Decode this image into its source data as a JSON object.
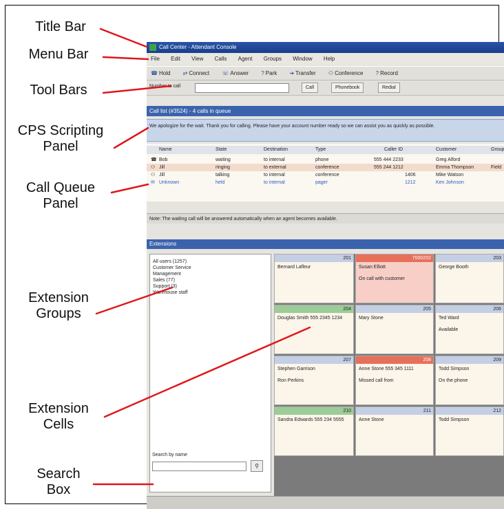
{
  "callouts": {
    "title_bar": "Title Bar",
    "menu_bar": "Menu Bar",
    "tool_bars": "Tool Bars",
    "cps_line1": "CPS Scripting",
    "cps_line2": "Panel",
    "queue_line1": "Call Queue",
    "queue_line2": "Panel",
    "groups_line1": "Extension",
    "groups_line2": "Groups",
    "cells_line1": "Extension",
    "cells_line2": "Cells",
    "search_line1": "Search",
    "search_line2": "Box"
  },
  "colors": {
    "callout_line": "#e0161b",
    "title_bar": "#1f4596",
    "panel_header": "#3b63ad",
    "script_panel": "#c9d6ea",
    "ringing_cell": "#e7705b",
    "talking_cell": "#9ccc97",
    "cells_background": "#7b7b7b"
  },
  "app": {
    "title": "Call Center - Attendant Console",
    "menu": [
      "File",
      "Edit",
      "View",
      "Calls",
      "Agent",
      "Groups",
      "Window",
      "Help"
    ],
    "toolbar_buttons": [
      {
        "icon": "hold-icon",
        "label": "Hold"
      },
      {
        "icon": "transfer-icon",
        "label": "Connect"
      },
      {
        "icon": "answer-icon",
        "label": "Answer"
      },
      {
        "icon": "park-icon",
        "label": "Park"
      },
      {
        "icon": "transfer-icon",
        "label": "Transfer"
      },
      {
        "icon": "conference-icon",
        "label": "Conference"
      },
      {
        "icon": "record-icon",
        "label": "Record"
      }
    ],
    "dial_label": "Number to call",
    "dial_buttons": [
      "Call",
      "Phonebook",
      "Redial"
    ],
    "call_list_title": "Call list (#3524) - 4 calls in queue",
    "script_text": "We apologize for the wait. Thank you for calling. Please have your account number ready so we can assist you as quickly as possible.",
    "queue_columns": [
      "Name",
      "State",
      "Destination",
      "Type",
      "Caller ID",
      "Customer",
      "Group"
    ],
    "queue_rows": [
      {
        "name": "Bob",
        "state": "waiting",
        "dest": "to internal",
        "type": "phone",
        "cid": "555 444 2233",
        "cust": "Greg Alford",
        "grp": ""
      },
      {
        "name": "Jill",
        "state": "ringing",
        "dest": "to external",
        "type": "conference",
        "cid": "555 244 1212",
        "cust": "Emma Thompson",
        "grp": "Field"
      },
      {
        "name": "Jill",
        "state": "talking",
        "dest": "to internal",
        "type": "conference",
        "cid": "1406",
        "cust": "Mike Watson",
        "grp": ""
      },
      {
        "name": "Unknown",
        "state": "held",
        "dest": "to internal",
        "type": "pager",
        "cid": "1212",
        "cust": "Ken Johnson",
        "grp": ""
      }
    ],
    "status_text": "Note: The waiting call will be answered automatically when an agent becomes available.",
    "extensions_title": "Extensions",
    "groups": [
      "All users (1257)",
      "Customer Service",
      "Management",
      "Sales (77)",
      "Support (3)",
      "Warehouse staff"
    ],
    "search_label": "Search by name",
    "search_button": "⚲",
    "cells": [
      {
        "ext": "201",
        "name": "Bernard Lafleur",
        "status": "",
        "kind": "idle"
      },
      {
        "ext": "7000202",
        "name": "Susan Elliott",
        "status": "On call with customer",
        "kind": "ring"
      },
      {
        "ext": "203",
        "name": "George Booth",
        "status": "",
        "kind": "idle"
      },
      {
        "ext": "204",
        "name": "Douglas Smith 555 2345 1234",
        "status": "",
        "kind": "talk"
      },
      {
        "ext": "205",
        "name": "Mary Stone",
        "status": "",
        "kind": "idle"
      },
      {
        "ext": "206",
        "name": "Ted Ward",
        "status": "Available",
        "kind": "idle"
      },
      {
        "ext": "207",
        "name": "Stephen Garrison",
        "status": "Ron Perkins",
        "kind": "idle"
      },
      {
        "ext": "208",
        "name": "Anne Stone 555 345 1111",
        "status": "Missed call from",
        "kind": "ring"
      },
      {
        "ext": "209",
        "name": "Todd Simpson",
        "status": "On the phone",
        "kind": "idle"
      },
      {
        "ext": "210",
        "name": "Sandra Edwards 555 234 5555",
        "status": "",
        "kind": "talk"
      },
      {
        "ext": "211",
        "name": "Anne Stone",
        "status": "",
        "kind": "idle"
      },
      {
        "ext": "212",
        "name": "Todd Simpson",
        "status": "",
        "kind": "idle"
      }
    ]
  }
}
